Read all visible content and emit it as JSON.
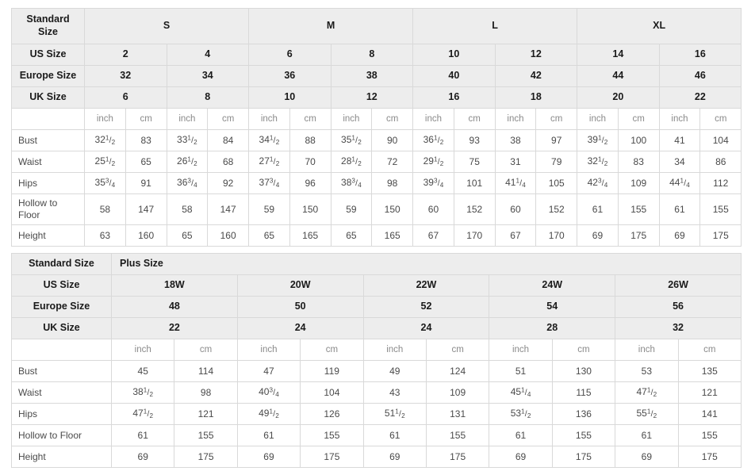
{
  "standard_table": {
    "label_col_header": "Standard\nSize",
    "label_col_header_line1": "Standard",
    "label_col_header_line2": "Size",
    "size_groups": [
      "S",
      "M",
      "L",
      "XL"
    ],
    "rows_header": [
      {
        "label": "US Size",
        "values": [
          "2",
          "4",
          "6",
          "8",
          "10",
          "12",
          "14",
          "16"
        ]
      },
      {
        "label": "Europe Size",
        "values": [
          "32",
          "34",
          "36",
          "38",
          "40",
          "42",
          "44",
          "46"
        ]
      },
      {
        "label": "UK Size",
        "values": [
          "6",
          "8",
          "10",
          "12",
          "16",
          "18",
          "20",
          "22"
        ]
      }
    ],
    "unit_row": {
      "label": "",
      "units": [
        "inch",
        "cm",
        "inch",
        "cm",
        "inch",
        "cm",
        "inch",
        "cm",
        "inch",
        "cm",
        "inch",
        "cm",
        "inch",
        "cm",
        "inch",
        "cm"
      ]
    },
    "measure_rows": [
      {
        "label": "Bust",
        "cells": [
          {
            "whole": "32",
            "num": "1",
            "den": "2"
          },
          {
            "plain": "83"
          },
          {
            "whole": "33",
            "num": "1",
            "den": "2"
          },
          {
            "plain": "84"
          },
          {
            "whole": "34",
            "num": "1",
            "den": "2"
          },
          {
            "plain": "88"
          },
          {
            "whole": "35",
            "num": "1",
            "den": "2"
          },
          {
            "plain": "90"
          },
          {
            "whole": "36",
            "num": "1",
            "den": "2"
          },
          {
            "plain": "93"
          },
          {
            "plain": "38"
          },
          {
            "plain": "97"
          },
          {
            "whole": "39",
            "num": "1",
            "den": "2"
          },
          {
            "plain": "100"
          },
          {
            "plain": "41"
          },
          {
            "plain": "104"
          }
        ]
      },
      {
        "label": "Waist",
        "cells": [
          {
            "whole": "25",
            "num": "1",
            "den": "2"
          },
          {
            "plain": "65"
          },
          {
            "whole": "26",
            "num": "1",
            "den": "2"
          },
          {
            "plain": "68"
          },
          {
            "whole": "27",
            "num": "1",
            "den": "2"
          },
          {
            "plain": "70"
          },
          {
            "whole": "28",
            "num": "1",
            "den": "2"
          },
          {
            "plain": "72"
          },
          {
            "whole": "29",
            "num": "1",
            "den": "2"
          },
          {
            "plain": "75"
          },
          {
            "plain": "31"
          },
          {
            "plain": "79"
          },
          {
            "whole": "32",
            "num": "1",
            "den": "2"
          },
          {
            "plain": "83"
          },
          {
            "plain": "34"
          },
          {
            "plain": "86"
          }
        ]
      },
      {
        "label": "Hips",
        "cells": [
          {
            "whole": "35",
            "num": "3",
            "den": "4"
          },
          {
            "plain": "91"
          },
          {
            "whole": "36",
            "num": "3",
            "den": "4"
          },
          {
            "plain": "92"
          },
          {
            "whole": "37",
            "num": "3",
            "den": "4"
          },
          {
            "plain": "96"
          },
          {
            "whole": "38",
            "num": "3",
            "den": "4"
          },
          {
            "plain": "98"
          },
          {
            "whole": "39",
            "num": "3",
            "den": "4"
          },
          {
            "plain": "101"
          },
          {
            "whole": "41",
            "num": "1",
            "den": "4"
          },
          {
            "plain": "105"
          },
          {
            "whole": "42",
            "num": "3",
            "den": "4"
          },
          {
            "plain": "109"
          },
          {
            "whole": "44",
            "num": "1",
            "den": "4"
          },
          {
            "plain": "112"
          }
        ]
      },
      {
        "label": "Hollow to Floor",
        "label_line1": "Hollow to",
        "label_line2": "Floor",
        "tall": true,
        "cells": [
          {
            "plain": "58"
          },
          {
            "plain": "147"
          },
          {
            "plain": "58"
          },
          {
            "plain": "147"
          },
          {
            "plain": "59"
          },
          {
            "plain": "150"
          },
          {
            "plain": "59"
          },
          {
            "plain": "150"
          },
          {
            "plain": "60"
          },
          {
            "plain": "152"
          },
          {
            "plain": "60"
          },
          {
            "plain": "152"
          },
          {
            "plain": "61"
          },
          {
            "plain": "155"
          },
          {
            "plain": "61"
          },
          {
            "plain": "155"
          }
        ]
      },
      {
        "label": "Height",
        "cells": [
          {
            "plain": "63"
          },
          {
            "plain": "160"
          },
          {
            "plain": "65"
          },
          {
            "plain": "160"
          },
          {
            "plain": "65"
          },
          {
            "plain": "165"
          },
          {
            "plain": "65"
          },
          {
            "plain": "165"
          },
          {
            "plain": "67"
          },
          {
            "plain": "170"
          },
          {
            "plain": "67"
          },
          {
            "plain": "170"
          },
          {
            "plain": "69"
          },
          {
            "plain": "175"
          },
          {
            "plain": "69"
          },
          {
            "plain": "175"
          }
        ]
      }
    ]
  },
  "plus_table": {
    "label_col_header": "Standard Size",
    "group_title": "Plus Size",
    "rows_header": [
      {
        "label": "US Size",
        "values": [
          "18W",
          "20W",
          "22W",
          "24W",
          "26W"
        ]
      },
      {
        "label": "Europe Size",
        "values": [
          "48",
          "50",
          "52",
          "54",
          "56"
        ]
      },
      {
        "label": "UK Size",
        "values": [
          "22",
          "24",
          "24",
          "28",
          "32"
        ]
      }
    ],
    "unit_row": {
      "label": "",
      "units": [
        "inch",
        "cm",
        "inch",
        "cm",
        "inch",
        "cm",
        "inch",
        "cm",
        "inch",
        "cm"
      ]
    },
    "measure_rows": [
      {
        "label": "Bust",
        "cells": [
          {
            "plain": "45"
          },
          {
            "plain": "114"
          },
          {
            "plain": "47"
          },
          {
            "plain": "119"
          },
          {
            "plain": "49"
          },
          {
            "plain": "124"
          },
          {
            "plain": "51"
          },
          {
            "plain": "130"
          },
          {
            "plain": "53"
          },
          {
            "plain": "135"
          }
        ]
      },
      {
        "label": "Waist",
        "cells": [
          {
            "whole": "38",
            "num": "1",
            "den": "2"
          },
          {
            "plain": "98"
          },
          {
            "whole": "40",
            "num": "3",
            "den": "4"
          },
          {
            "plain": "104"
          },
          {
            "plain": "43"
          },
          {
            "plain": "109"
          },
          {
            "whole": "45",
            "num": "1",
            "den": "4"
          },
          {
            "plain": "115"
          },
          {
            "whole": "47",
            "num": "1",
            "den": "2"
          },
          {
            "plain": "121"
          }
        ]
      },
      {
        "label": "Hips",
        "cells": [
          {
            "whole": "47",
            "num": "1",
            "den": "2"
          },
          {
            "plain": "121"
          },
          {
            "whole": "49",
            "num": "1",
            "den": "2"
          },
          {
            "plain": "126"
          },
          {
            "whole": "51",
            "num": "1",
            "den": "2"
          },
          {
            "plain": "131"
          },
          {
            "whole": "53",
            "num": "1",
            "den": "2"
          },
          {
            "plain": "136"
          },
          {
            "whole": "55",
            "num": "1",
            "den": "2"
          },
          {
            "plain": "141"
          }
        ]
      },
      {
        "label": "Hollow to Floor",
        "cells": [
          {
            "plain": "61"
          },
          {
            "plain": "155"
          },
          {
            "plain": "61"
          },
          {
            "plain": "155"
          },
          {
            "plain": "61"
          },
          {
            "plain": "155"
          },
          {
            "plain": "61"
          },
          {
            "plain": "155"
          },
          {
            "plain": "61"
          },
          {
            "plain": "155"
          }
        ]
      },
      {
        "label": "Height",
        "cells": [
          {
            "plain": "69"
          },
          {
            "plain": "175"
          },
          {
            "plain": "69"
          },
          {
            "plain": "175"
          },
          {
            "plain": "69"
          },
          {
            "plain": "175"
          },
          {
            "plain": "69"
          },
          {
            "plain": "175"
          },
          {
            "plain": "69"
          },
          {
            "plain": "175"
          }
        ]
      }
    ]
  },
  "colors": {
    "header_bg": "#ededed",
    "cell_bg": "#ffffff",
    "border": "#d9d9d9",
    "header_text": "#1a1a1a",
    "cell_text": "#4a4a4a",
    "unit_text": "#8a8a8a"
  }
}
